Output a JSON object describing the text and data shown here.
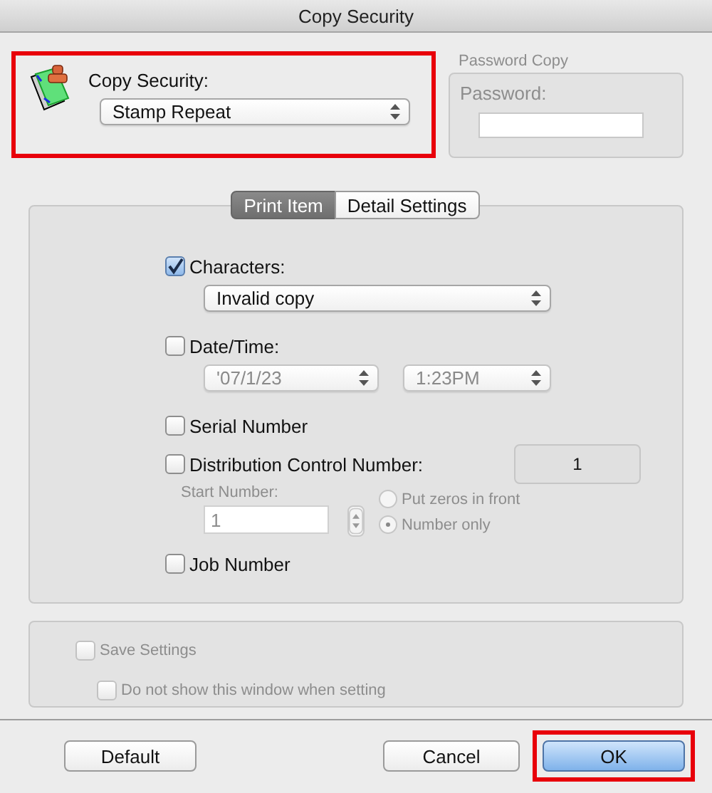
{
  "window": {
    "title": "Copy Security"
  },
  "copy_security": {
    "label": "Copy Security:",
    "value": "Stamp Repeat",
    "highlighted": true
  },
  "password_copy": {
    "title": "Password Copy",
    "label": "Password:",
    "disabled": true
  },
  "tabs": [
    {
      "label": "Print Item",
      "selected": true
    },
    {
      "label": "Detail Settings",
      "selected": false
    }
  ],
  "print_items": [
    {
      "kind": "select",
      "label": "Characters:",
      "checked": true,
      "value": "Invalid copy"
    },
    {
      "kind": "datetime",
      "label": "Date/Time:",
      "checked": false,
      "date": "'07/1/23",
      "time": "1:23PM"
    },
    {
      "kind": "plain",
      "label": "Serial Number",
      "checked": false
    },
    {
      "kind": "distribution",
      "label": "Distribution Control Number:",
      "checked": false,
      "display": "1",
      "start_label": "Start Number:",
      "start_value": "1",
      "options": [
        {
          "label": "Put zeros in front",
          "selected": false
        },
        {
          "label": "Number only",
          "selected": true
        }
      ]
    },
    {
      "kind": "plain",
      "label": "Job Number",
      "checked": false
    }
  ],
  "save_settings": {
    "label": "Save Settings",
    "checked": false,
    "disabled": true
  },
  "dont_show": {
    "label": "Do not show this window when setting",
    "checked": false,
    "disabled": true
  },
  "buttons": [
    {
      "label": "Default",
      "kind": "normal",
      "highlighted": false
    },
    {
      "label": "Cancel",
      "kind": "normal",
      "highlighted": false
    },
    {
      "label": "OK",
      "kind": "default",
      "highlighted": true
    }
  ]
}
